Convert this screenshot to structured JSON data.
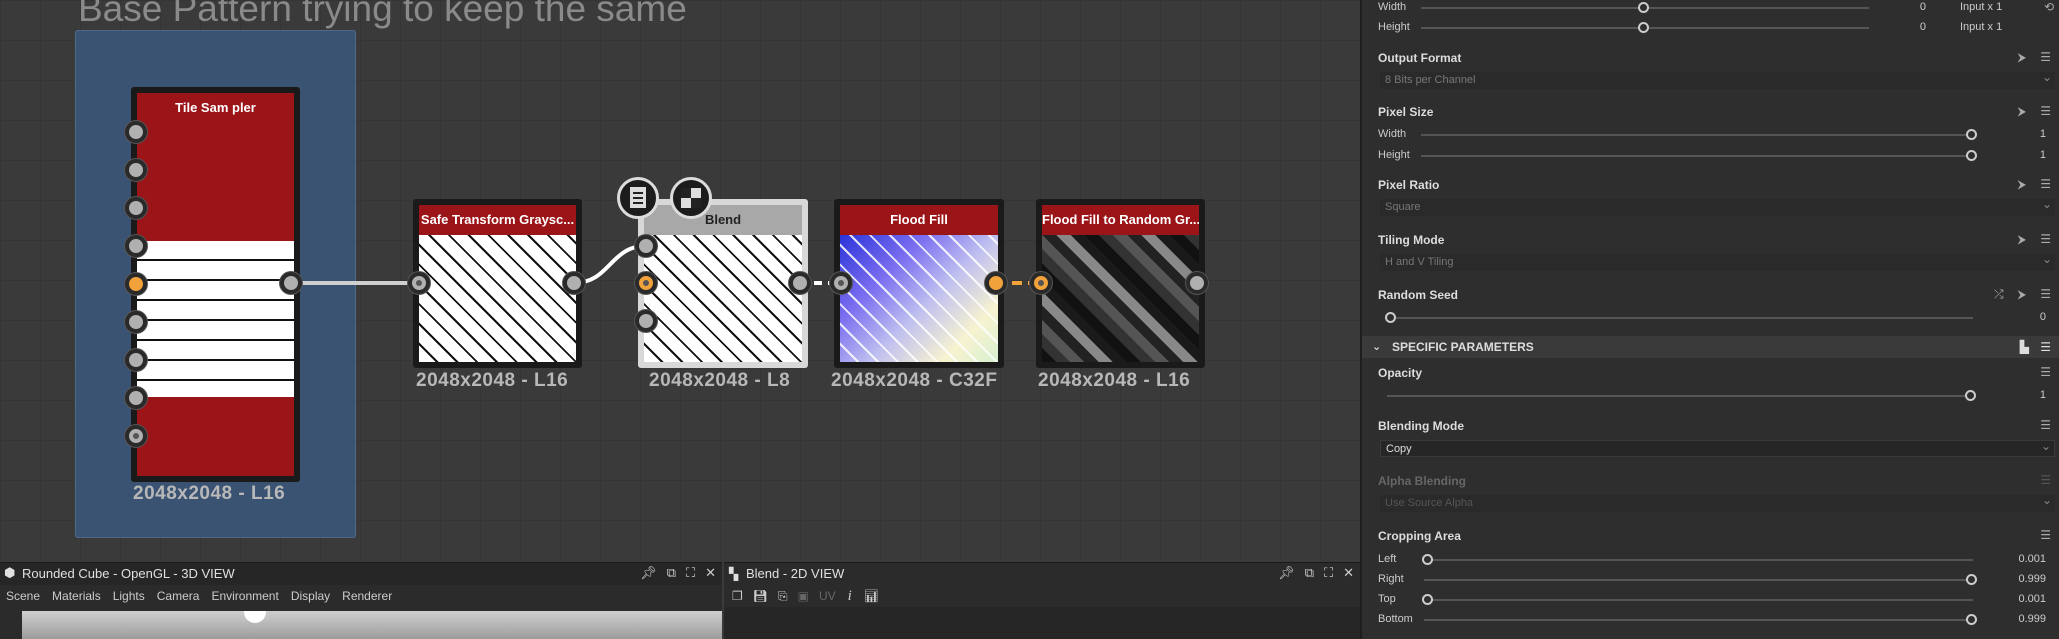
{
  "graph": {
    "frame_title": "Base Pattern trying to keep the same",
    "nodes": {
      "tile_sampler": {
        "title": "Tile Sam pler",
        "resolution": "2048x2048 - L16"
      },
      "safe_transform": {
        "title": "Safe Transform Graysc...",
        "resolution": "2048x2048 - L16"
      },
      "blend": {
        "title": "Blend",
        "resolution": "2048x2048 - L8"
      },
      "flood_fill": {
        "title": "Flood Fill",
        "resolution": "2048x2048 - C32F"
      },
      "flood_fill_random": {
        "title": "Flood Fill to Random Gr...",
        "resolution": "2048x2048 - L16"
      }
    }
  },
  "view3d": {
    "title": "Rounded Cube - OpenGL - 3D VIEW",
    "menu": [
      "Scene",
      "Materials",
      "Lights",
      "Camera",
      "Environment",
      "Display",
      "Renderer"
    ]
  },
  "view2d": {
    "title": "Blend - 2D VIEW",
    "uv_label": "UV"
  },
  "props": {
    "width": {
      "label": "Width",
      "value": "0",
      "suffix": "Input x 1"
    },
    "height": {
      "label": "Height",
      "value": "0",
      "suffix": "Input x 1"
    },
    "output_format": {
      "label": "Output Format",
      "value": "8 Bits per Channel"
    },
    "pixel_size": {
      "label": "Pixel Size",
      "width_label": "Width",
      "width_value": "1",
      "height_label": "Height",
      "height_value": "1"
    },
    "pixel_ratio": {
      "label": "Pixel Ratio",
      "value": "Square"
    },
    "tiling_mode": {
      "label": "Tiling Mode",
      "value": "H and V Tiling"
    },
    "random_seed": {
      "label": "Random Seed",
      "value": "0"
    },
    "specific_header": "SPECIFIC PARAMETERS",
    "opacity": {
      "label": "Opacity",
      "value": "1"
    },
    "blending_mode": {
      "label": "Blending Mode",
      "value": "Copy"
    },
    "alpha_blending": {
      "label": "Alpha Blending",
      "value": "Use Source Alpha"
    },
    "cropping_area": {
      "label": "Cropping Area",
      "left": {
        "label": "Left",
        "value": "0.001"
      },
      "right": {
        "label": "Right",
        "value": "0.999"
      },
      "top": {
        "label": "Top",
        "value": "0.001"
      },
      "bottom": {
        "label": "Bottom",
        "value": "0.999"
      }
    }
  },
  "colors": {
    "accent_orange": "#f2a23a",
    "node_header_red": "#9b1418",
    "frame_blue": "#3b5373"
  }
}
